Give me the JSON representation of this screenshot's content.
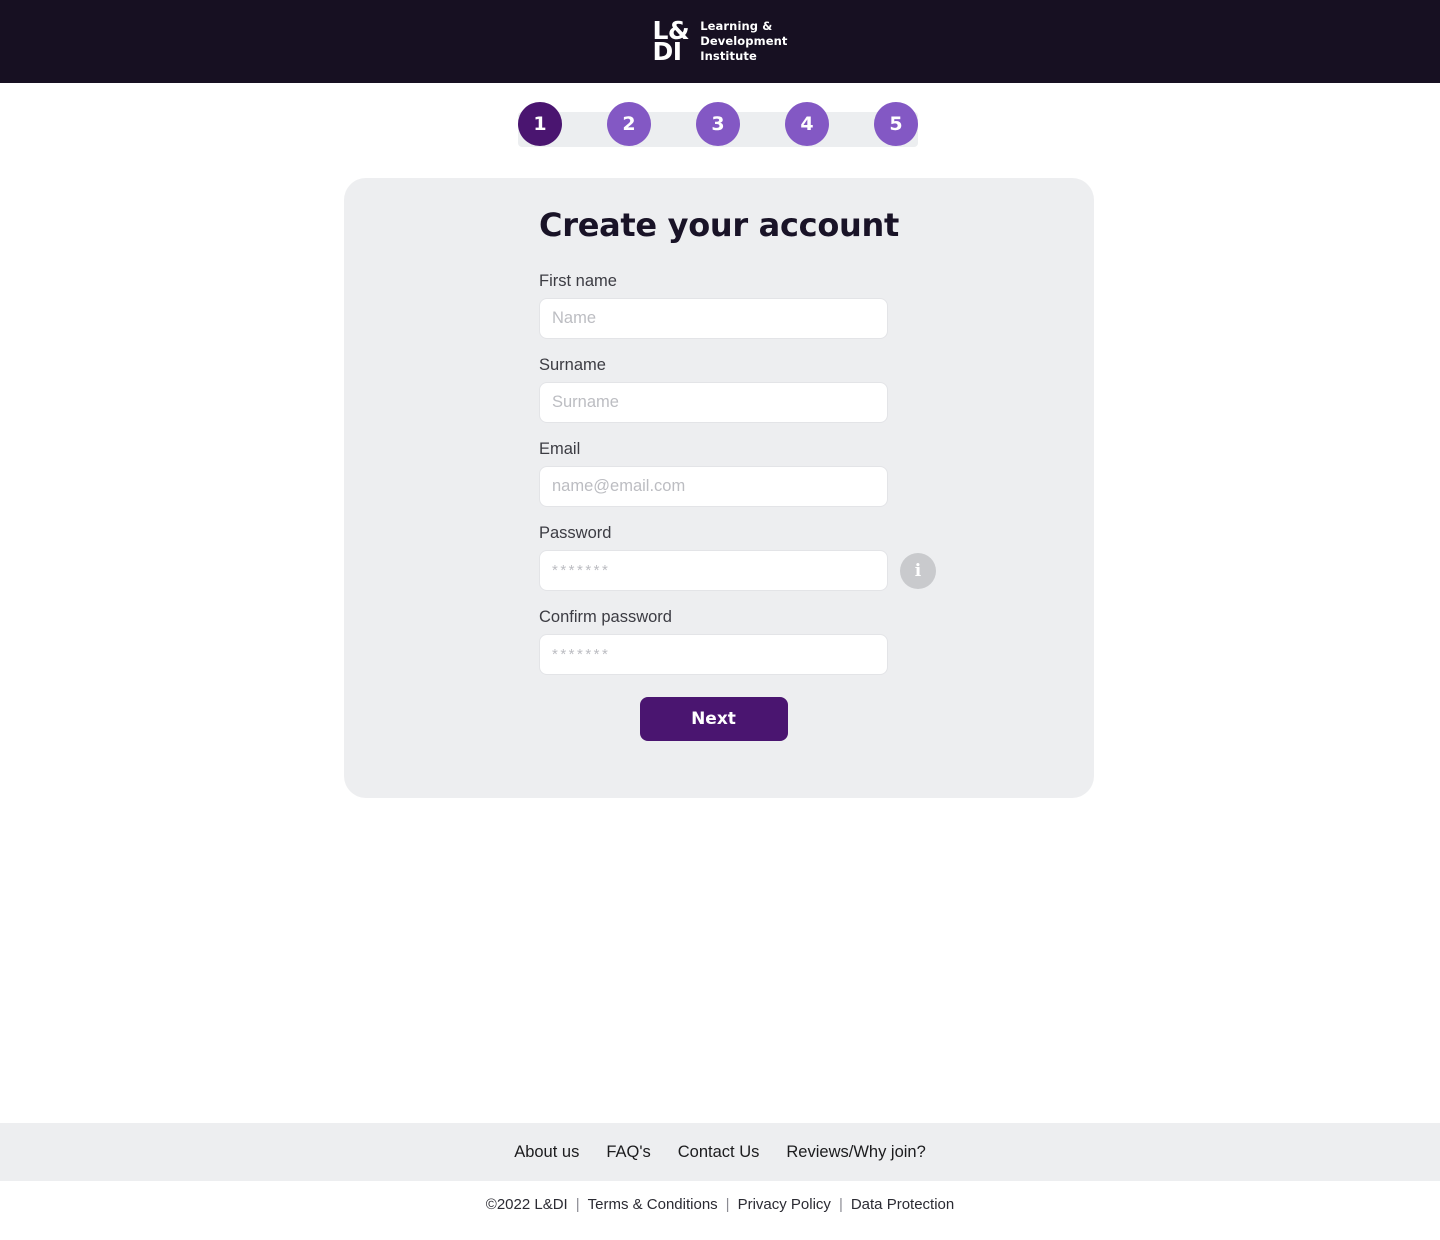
{
  "header": {
    "logo": {
      "mark_top": "L&",
      "mark_bottom": "DI",
      "word_line1": "Learning &",
      "word_line2": "Development",
      "word_line3": "Institute",
      "background": "#171022"
    }
  },
  "stepper": {
    "active_color": "#4a1570",
    "inactive_color": "#8358c4",
    "track_color": "#eceef0",
    "current": 1,
    "steps": [
      {
        "label": "1",
        "state": "active"
      },
      {
        "label": "2",
        "state": "inactive"
      },
      {
        "label": "3",
        "state": "inactive"
      },
      {
        "label": "4",
        "state": "inactive"
      },
      {
        "label": "5",
        "state": "inactive"
      }
    ]
  },
  "card": {
    "title": "Create your account",
    "background": "#edeef0",
    "fields": [
      {
        "label": "First name",
        "value": "",
        "placeholder": "Name"
      },
      {
        "label": "Surname",
        "value": "",
        "placeholder": "Surname"
      },
      {
        "label": "Email",
        "value": "",
        "placeholder": "name@email.com"
      },
      {
        "label": "Password",
        "value": "",
        "placeholder": "*******",
        "info_icon": "i"
      },
      {
        "label": "Confirm password",
        "value": "",
        "placeholder": "*******"
      }
    ],
    "submit_label": "Next",
    "submit_color": "#4a1570"
  },
  "footer": {
    "links": [
      {
        "label": "About us"
      },
      {
        "label": "FAQ's"
      },
      {
        "label": "Contact Us"
      },
      {
        "label": "Reviews/Why join?"
      }
    ],
    "copyright": "©2022 L&DI",
    "separator": "|",
    "legal_links": [
      {
        "label": "Terms & Conditions"
      },
      {
        "label": "Privacy Policy"
      },
      {
        "label": "Data Protection"
      }
    ]
  }
}
